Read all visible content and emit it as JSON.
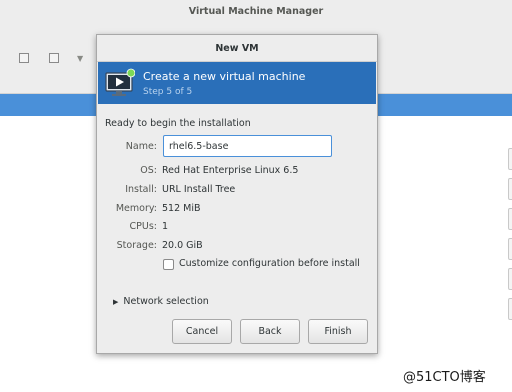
{
  "background_window": {
    "title": "Virtual Machine Manager"
  },
  "dialog": {
    "title": "New VM",
    "banner": {
      "title": "Create a new virtual machine",
      "step": "Step 5 of 5",
      "icon": "monitor-play-icon"
    },
    "ready_text": "Ready to begin the installation",
    "name_label": "Name:",
    "name_value": "rhel6.5-base",
    "details": [
      {
        "label": "OS:",
        "value": "Red Hat Enterprise Linux 6.5"
      },
      {
        "label": "Install:",
        "value": "URL Install Tree"
      },
      {
        "label": "Memory:",
        "value": "512 MiB"
      },
      {
        "label": "CPUs:",
        "value": "1"
      },
      {
        "label": "Storage:",
        "value": "20.0 GiB"
      }
    ],
    "customize_label": "Customize configuration before install",
    "customize_checked": false,
    "network_selection": "Network selection",
    "buttons": {
      "cancel": "Cancel",
      "back": "Back",
      "finish": "Finish"
    }
  },
  "colors": {
    "banner": "#2a6fb9",
    "selection": "#4a90d9"
  },
  "watermark": "@51CTO博客"
}
